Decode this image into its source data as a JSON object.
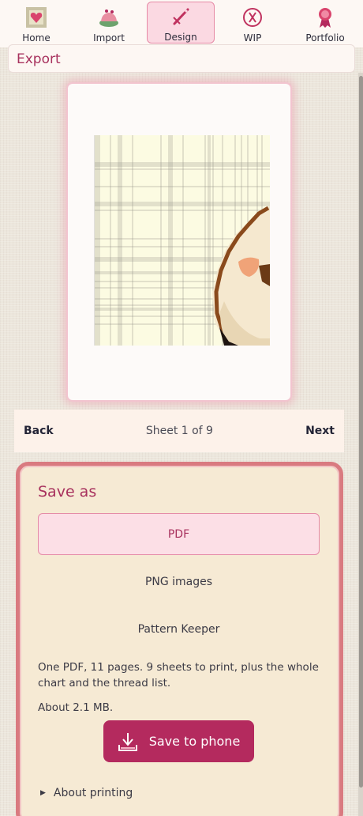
{
  "nav": {
    "items": [
      {
        "label": "Home",
        "icon": "cross-stitch-heart-icon"
      },
      {
        "label": "Import",
        "icon": "pincushion-icon"
      },
      {
        "label": "Design",
        "icon": "needle-icon",
        "active": true
      },
      {
        "label": "WIP",
        "icon": "thread-spool-icon"
      },
      {
        "label": "Portfolio",
        "icon": "award-ribbon-icon"
      }
    ]
  },
  "header": {
    "title": "Export"
  },
  "preview": {
    "description_icon": "pattern-sheet-preview"
  },
  "pager": {
    "back": "Back",
    "status": "Sheet 1 of 9",
    "next": "Next"
  },
  "save_as": {
    "title": "Save as",
    "options": [
      "PDF",
      "PNG images",
      "Pattern Keeper"
    ],
    "selected": "PDF",
    "summary": "One PDF, 11 pages. 9 sheets to print, plus the whole chart and the thread list.",
    "size": "About 2.1 MB.",
    "save_button": "Save to phone",
    "save_icon": "download-tray-icon",
    "about_printing": "About printing"
  },
  "colors": {
    "accent": "#b42a5e",
    "accent_light": "#fcdfe6",
    "card_border": "#d97a80",
    "card_bg": "#f6ead4"
  }
}
